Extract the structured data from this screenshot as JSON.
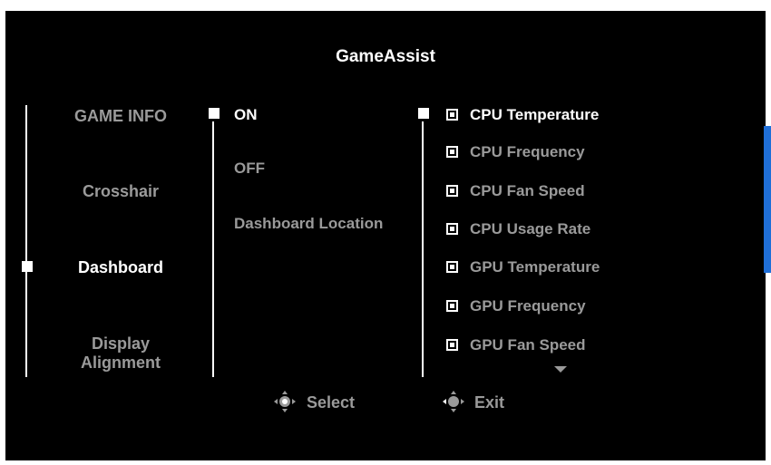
{
  "title": "GameAssist",
  "menu": {
    "items": [
      {
        "label": "GAME INFO",
        "active": false
      },
      {
        "label": "Crosshair",
        "active": false
      },
      {
        "label": "Dashboard",
        "active": true
      },
      {
        "label_line1": "Display",
        "label_line2": "Alignment",
        "active": false
      }
    ]
  },
  "options": {
    "items": [
      {
        "label": "ON",
        "selected": true
      },
      {
        "label": "OFF",
        "selected": false
      },
      {
        "label": "Dashboard Location",
        "selected": false
      }
    ]
  },
  "info_list": {
    "items": [
      {
        "label": "CPU Temperature",
        "checked": true,
        "highlighted": true
      },
      {
        "label": "CPU Frequency",
        "checked": true,
        "highlighted": false
      },
      {
        "label": "CPU Fan Speed",
        "checked": true,
        "highlighted": false
      },
      {
        "label": "CPU Usage Rate",
        "checked": true,
        "highlighted": false
      },
      {
        "label": "GPU Temperature",
        "checked": true,
        "highlighted": false
      },
      {
        "label": "GPU Frequency",
        "checked": true,
        "highlighted": false
      },
      {
        "label": "GPU Fan Speed",
        "checked": true,
        "highlighted": false
      }
    ]
  },
  "footer": {
    "select_label": "Select",
    "exit_label": "Exit"
  },
  "colors": {
    "background": "#000000",
    "text_active": "#ffffff",
    "text_inactive": "#9a9a9a",
    "scrollbar": "#1f6fd8"
  },
  "icons": {
    "select": "joystick-press-icon",
    "exit": "joystick-left-icon",
    "more": "chevron-down-icon"
  }
}
